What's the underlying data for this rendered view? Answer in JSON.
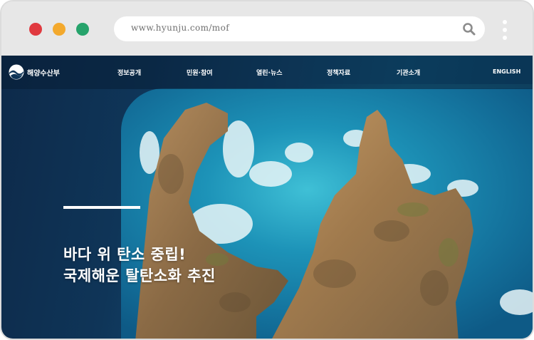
{
  "browser": {
    "url": "www.hyunju.com/mof",
    "colors": {
      "close": "#e0393f",
      "minimize": "#f3a92d",
      "maximize": "#26a36b"
    }
  },
  "site": {
    "logo_text": "해양수산부",
    "nav": [
      "정보공개",
      "민원·참여",
      "열린·뉴스",
      "정책자료",
      "기관소개"
    ],
    "language_link": "ENGLISH"
  },
  "hero": {
    "line1": "바다 위 탄소 중립!",
    "line2": "국제해운 탈탄소화 추진"
  }
}
